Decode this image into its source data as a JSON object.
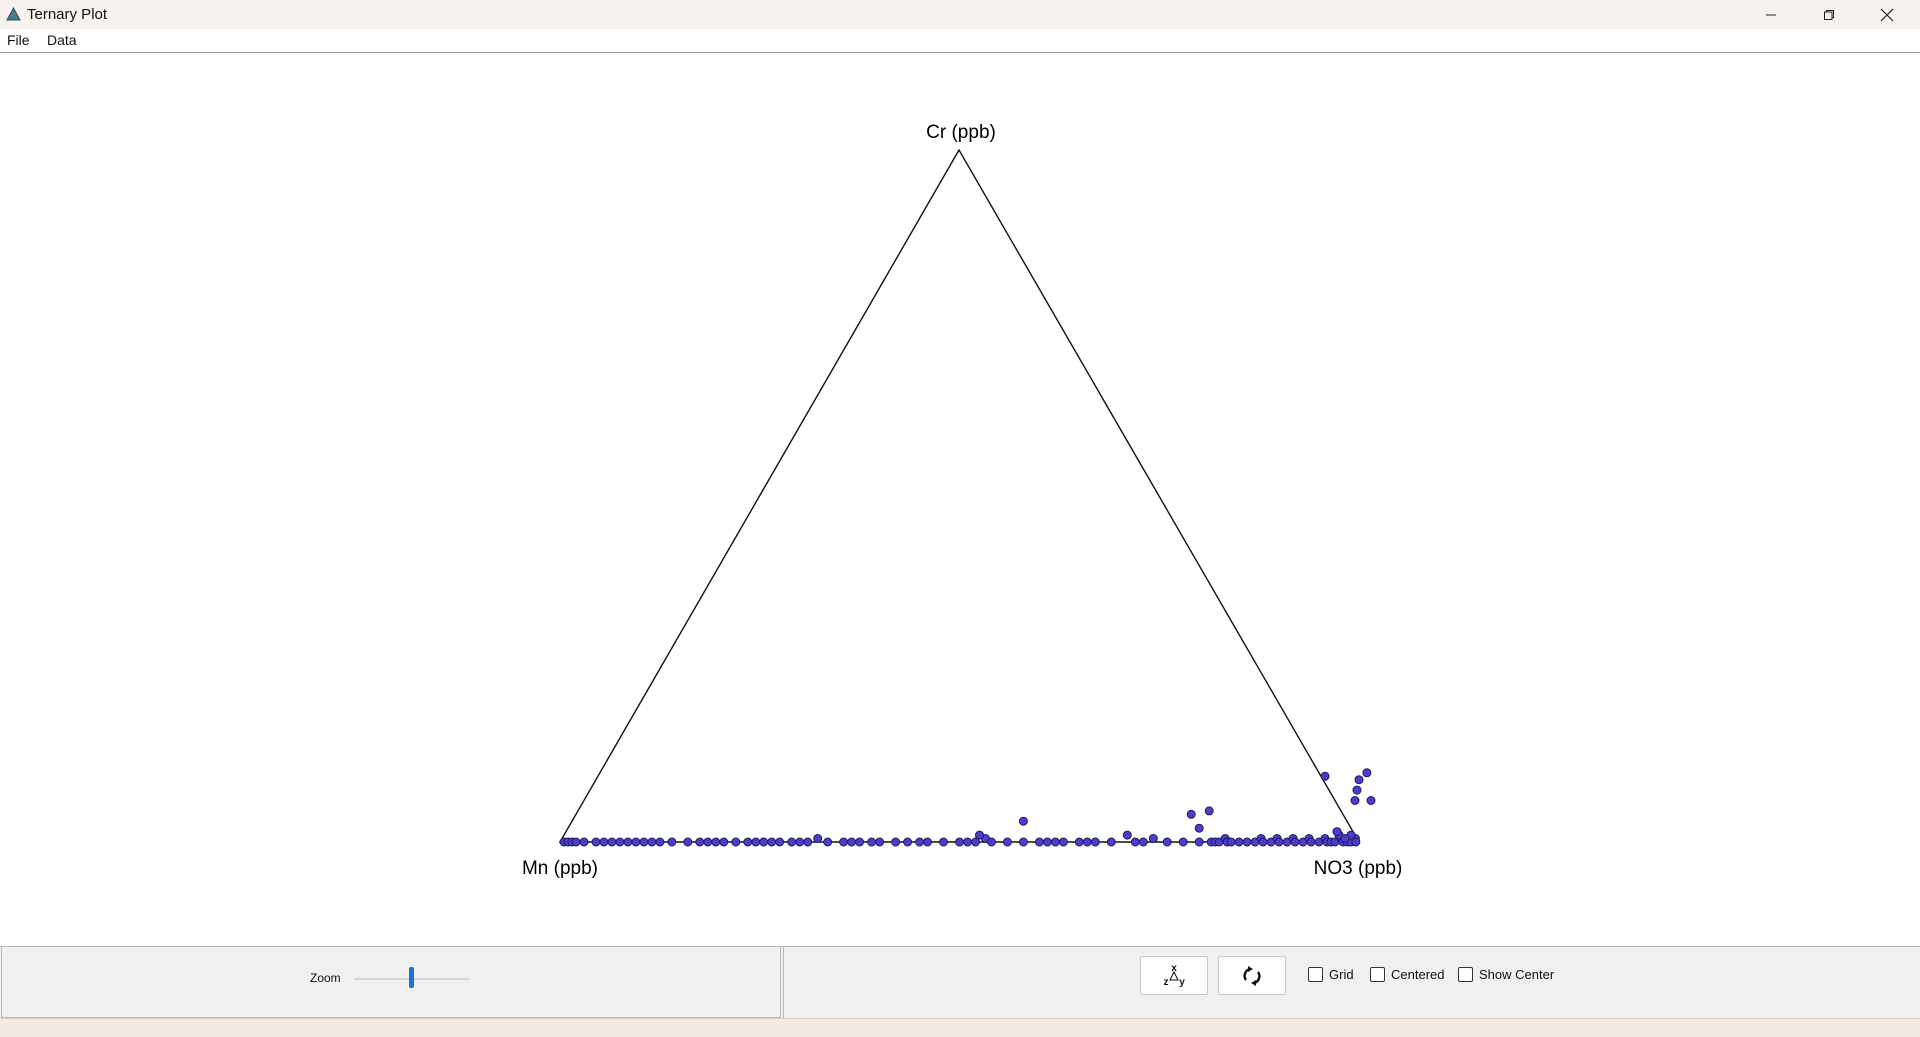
{
  "window": {
    "title": "Ternary Plot",
    "accent": "#1a74d8"
  },
  "menu": {
    "items": [
      {
        "label": "File"
      },
      {
        "label": "Data"
      }
    ]
  },
  "chart_data": {
    "type": "scatter",
    "subtype": "ternary",
    "axes": {
      "top": "Cr (ppb)",
      "left": "Mn (ppb)",
      "right": "NO3 (ppb)"
    },
    "grid": false,
    "marker_color": "#4a3fc9",
    "marker_edge_color": "#1f1a5c",
    "points_note_units": "fractions [Cr, NO3] of composition",
    "points": [
      [
        0.0,
        0.005
      ],
      [
        0.0,
        0.01
      ],
      [
        0.0,
        0.015
      ],
      [
        0.0,
        0.02
      ],
      [
        0.0,
        0.03
      ],
      [
        0.0,
        0.045
      ],
      [
        0.0,
        0.055
      ],
      [
        0.0,
        0.065
      ],
      [
        0.0,
        0.075
      ],
      [
        0.0,
        0.085
      ],
      [
        0.0,
        0.095
      ],
      [
        0.0,
        0.105
      ],
      [
        0.0,
        0.115
      ],
      [
        0.0,
        0.125
      ],
      [
        0.0,
        0.14
      ],
      [
        0.0,
        0.16
      ],
      [
        0.0,
        0.175
      ],
      [
        0.0,
        0.185
      ],
      [
        0.0,
        0.195
      ],
      [
        0.0,
        0.205
      ],
      [
        0.0,
        0.22
      ],
      [
        0.0,
        0.235
      ],
      [
        0.0,
        0.245
      ],
      [
        0.0,
        0.255
      ],
      [
        0.0,
        0.265
      ],
      [
        0.0,
        0.275
      ],
      [
        0.0,
        0.29
      ],
      [
        0.0,
        0.3
      ],
      [
        0.0,
        0.31
      ],
      [
        0.005,
        0.32
      ],
      [
        0.0,
        0.335
      ],
      [
        0.0,
        0.355
      ],
      [
        0.0,
        0.365
      ],
      [
        0.0,
        0.375
      ],
      [
        0.0,
        0.39
      ],
      [
        0.0,
        0.4
      ],
      [
        0.0,
        0.42
      ],
      [
        0.0,
        0.435
      ],
      [
        0.0,
        0.45
      ],
      [
        0.0,
        0.46
      ],
      [
        0.0,
        0.48
      ],
      [
        0.0,
        0.5
      ],
      [
        0.0,
        0.51
      ],
      [
        0.0,
        0.52
      ],
      [
        0.005,
        0.53
      ],
      [
        0.0,
        0.54
      ],
      [
        0.0,
        0.56
      ],
      [
        0.0,
        0.58
      ],
      [
        0.0,
        0.6
      ],
      [
        0.0,
        0.61
      ],
      [
        0.0,
        0.62
      ],
      [
        0.0,
        0.63
      ],
      [
        0.0,
        0.65
      ],
      [
        0.0,
        0.66
      ],
      [
        0.0,
        0.67
      ],
      [
        0.0,
        0.69
      ],
      [
        0.0,
        0.72
      ],
      [
        0.0,
        0.73
      ],
      [
        0.005,
        0.74
      ],
      [
        0.0,
        0.76
      ],
      [
        0.0,
        0.78
      ],
      [
        0.0,
        0.8
      ],
      [
        0.0,
        0.815
      ],
      [
        0.0,
        0.82
      ],
      [
        0.0,
        0.825
      ],
      [
        0.005,
        0.83
      ],
      [
        0.0,
        0.835
      ],
      [
        0.0,
        0.84
      ],
      [
        0.0,
        0.85
      ],
      [
        0.0,
        0.86
      ],
      [
        0.0,
        0.87
      ],
      [
        0.005,
        0.875
      ],
      [
        0.0,
        0.88
      ],
      [
        0.0,
        0.89
      ],
      [
        0.005,
        0.895
      ],
      [
        0.0,
        0.9
      ],
      [
        0.0,
        0.91
      ],
      [
        0.005,
        0.915
      ],
      [
        0.0,
        0.92
      ],
      [
        0.0,
        0.93
      ],
      [
        0.005,
        0.935
      ],
      [
        0.0,
        0.94
      ],
      [
        0.0,
        0.95
      ],
      [
        0.005,
        0.955
      ],
      [
        0.0,
        0.96
      ],
      [
        0.0,
        0.965
      ],
      [
        0.0,
        0.97
      ],
      [
        0.005,
        0.975
      ],
      [
        0.0,
        0.98
      ],
      [
        0.0,
        0.985
      ],
      [
        0.0,
        0.99
      ],
      [
        0.005,
        0.993
      ],
      [
        0.0,
        0.996
      ],
      [
        0.01,
        0.97
      ],
      [
        0.015,
        0.965
      ],
      [
        0.01,
        0.985
      ],
      [
        0.005,
        0.98
      ],
      [
        0.01,
        0.52
      ],
      [
        0.01,
        0.705
      ],
      [
        0.02,
        0.79
      ],
      [
        0.03,
        0.565
      ],
      [
        0.04,
        0.77
      ],
      [
        0.045,
        0.79
      ],
      [
        0.06,
        0.965
      ],
      [
        0.06,
        0.985
      ],
      [
        0.075,
        0.96
      ],
      [
        0.09,
        0.955
      ],
      [
        0.095,
        0.91
      ],
      [
        0.1,
        0.96
      ]
    ]
  },
  "controls": {
    "zoom_label": "Zoom",
    "zoom_value": 0.5,
    "axes_button_icon": "swap-axes-icon",
    "rotate_button_icon": "rotate-icon",
    "checkboxes": [
      {
        "label": "Grid",
        "checked": false
      },
      {
        "label": "Centered",
        "checked": false
      },
      {
        "label": "Show Center",
        "checked": false
      }
    ]
  }
}
